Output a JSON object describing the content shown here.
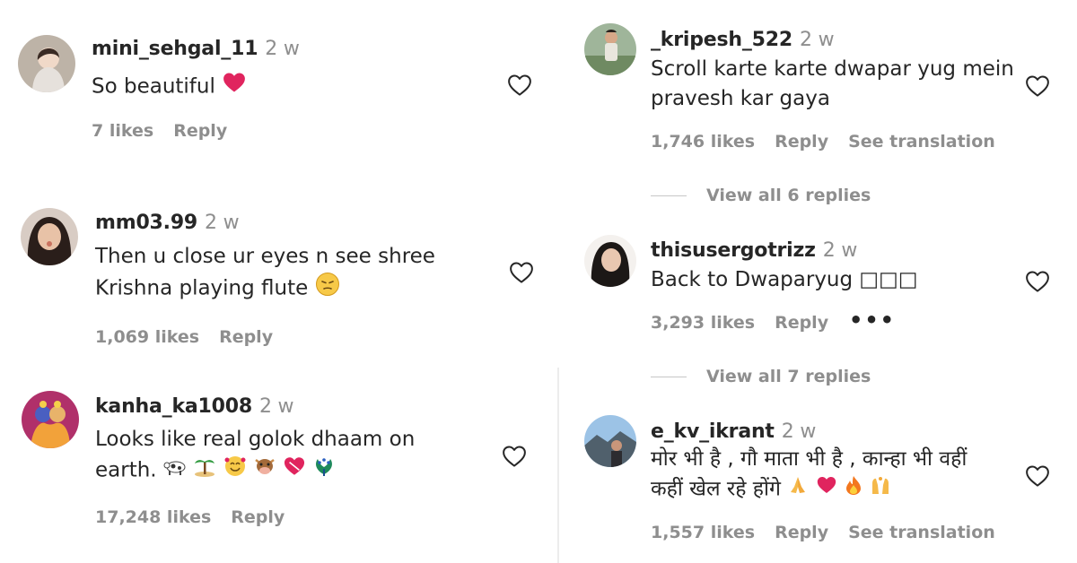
{
  "comments": [
    {
      "username": "mini_sehgal_11",
      "time": "2 w",
      "line1": "So beautiful",
      "line2": "",
      "likes": "7 likes",
      "reply": "Reply",
      "extra": ""
    },
    {
      "username": "mm03.99",
      "time": "2 w",
      "line1": "Then u close ur eyes n see shree",
      "line2": "Krishna playing flute",
      "likes": "1,069 likes",
      "reply": "Reply",
      "extra": ""
    },
    {
      "username": "kanha_ka1008",
      "time": "2 w",
      "line1": "Looks like real golok dhaam on",
      "line2": "earth.",
      "likes": "17,248 likes",
      "reply": "Reply",
      "extra": ""
    },
    {
      "username": "_kripesh_522",
      "time": "2 w",
      "line1": "Scroll karte karte dwapar yug mein",
      "line2": "pravesh kar gaya",
      "likes": "1,746 likes",
      "reply": "Reply",
      "extra": "See translation",
      "view_replies": "View all 6 replies"
    },
    {
      "username": "thisusergotrizz",
      "time": "2 w",
      "line1": "Back to Dwaparyug □□□",
      "line2": "",
      "likes": "3,293 likes",
      "reply": "Reply",
      "extra": "",
      "more": "•••",
      "view_replies": "View all 7 replies"
    },
    {
      "username": "e_kv_ikrant",
      "time": "2 w",
      "line1": "मोर भी है , गौ माता भी है , कान्हा भी वहीं",
      "line2": "कहीं खेल रहे होंगे",
      "likes": "1,557 likes",
      "reply": "Reply",
      "extra": "See translation"
    }
  ],
  "icons": {
    "like": "heart-outline-icon",
    "red_heart": "red-heart-emoji",
    "pensive": "pensive-face-emoji"
  },
  "colors": {
    "text": "#262626",
    "muted": "#8e8e8e",
    "heart_red": "#e0245e"
  }
}
